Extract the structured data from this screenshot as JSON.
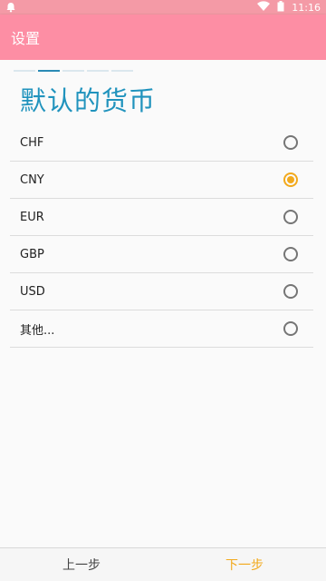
{
  "status_bar": {
    "time": "11:16",
    "icons": [
      "notification-icon",
      "wifi-icon",
      "battery-icon"
    ]
  },
  "app_bar": {
    "title": "设置"
  },
  "wizard": {
    "steps_total": 5,
    "current_step": 2,
    "title": "默认的货币",
    "selected": "CNY",
    "options": [
      {
        "label": "CHF",
        "checked": false
      },
      {
        "label": "CNY",
        "checked": true
      },
      {
        "label": "EUR",
        "checked": false
      },
      {
        "label": "GBP",
        "checked": false
      },
      {
        "label": "USD",
        "checked": false
      },
      {
        "label": "其他...",
        "checked": false
      }
    ]
  },
  "bottom_nav": {
    "prev_label": "上一步",
    "next_label": "下一步"
  },
  "colors": {
    "status_bar": "#f49aa6",
    "app_bar": "#fd8ea4",
    "title": "#2093bd",
    "accent": "#f2a91c"
  }
}
